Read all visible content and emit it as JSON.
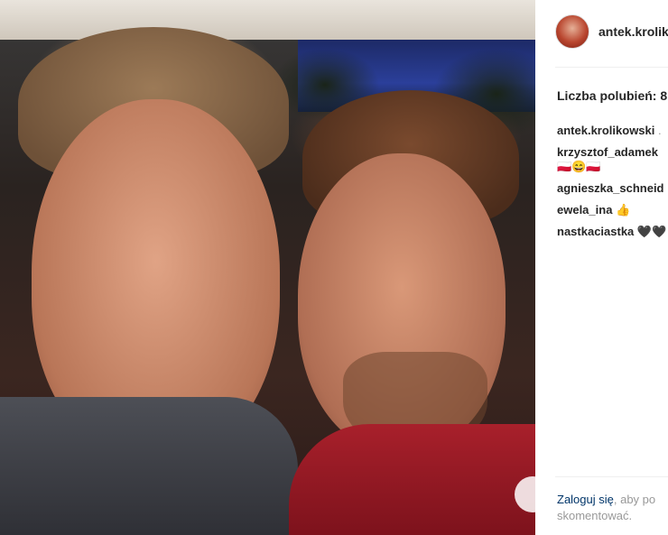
{
  "post": {
    "username": "antek.krolik",
    "likes_label": "Liczba polubień: 8",
    "comments": [
      {
        "user": "antek.krolikowski",
        "text": "."
      },
      {
        "user": "krzysztof_adamek",
        "text": "",
        "emoji": "🇵🇱😄🇵🇱"
      },
      {
        "user": "agnieszka_schneid",
        "text": ""
      },
      {
        "user": "ewela_ina",
        "text": "👍"
      },
      {
        "user": "nastkaciastka",
        "text": "🖤🖤"
      }
    ],
    "login_link": "Zaloguj się",
    "login_rest": ", aby po",
    "login_line2": "skomentować."
  },
  "icons": {
    "avatar": "avatar-icon",
    "photo_corner": "circle-icon"
  }
}
